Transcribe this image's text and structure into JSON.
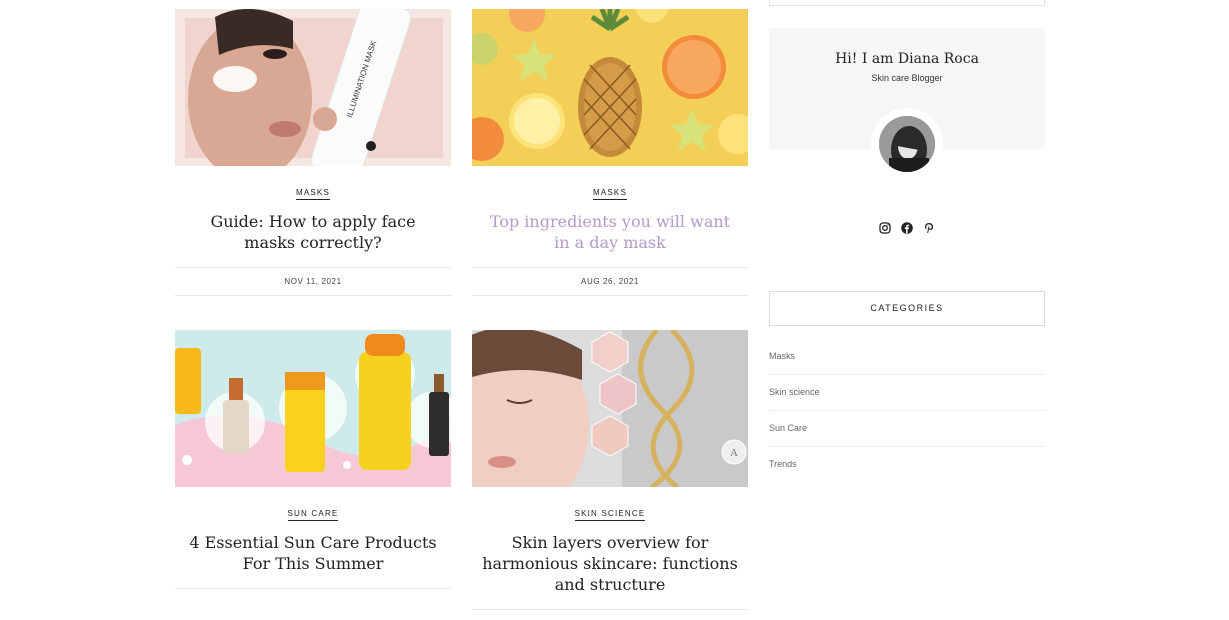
{
  "posts": [
    {
      "category": "MASKS",
      "title": "Guide: How to apply face masks correctly?",
      "date": "NOV 11, 2021"
    },
    {
      "category": "MASKS",
      "title": "Top ingredients you will want in a day mask",
      "date": "AUG 26, 2021"
    },
    {
      "category": "SUN CARE",
      "title": "4 Essential Sun Care Products For This Summer"
    },
    {
      "category": "SKIN SCIENCE",
      "title": "Skin layers overview for harmonious skincare: functions and structure"
    }
  ],
  "about": {
    "name": "Hi! I am Diana Roca",
    "role": "Skin care Blogger"
  },
  "social": [
    "instagram-icon",
    "facebook-icon",
    "pinterest-icon"
  ],
  "categories": {
    "heading": "CATEGORIES",
    "items": [
      "Masks",
      "Skin science",
      "Sun Care",
      "Trends"
    ]
  },
  "colors": {
    "highlight_title": "#b49ac9",
    "about_bg": "#f6f6f6"
  }
}
